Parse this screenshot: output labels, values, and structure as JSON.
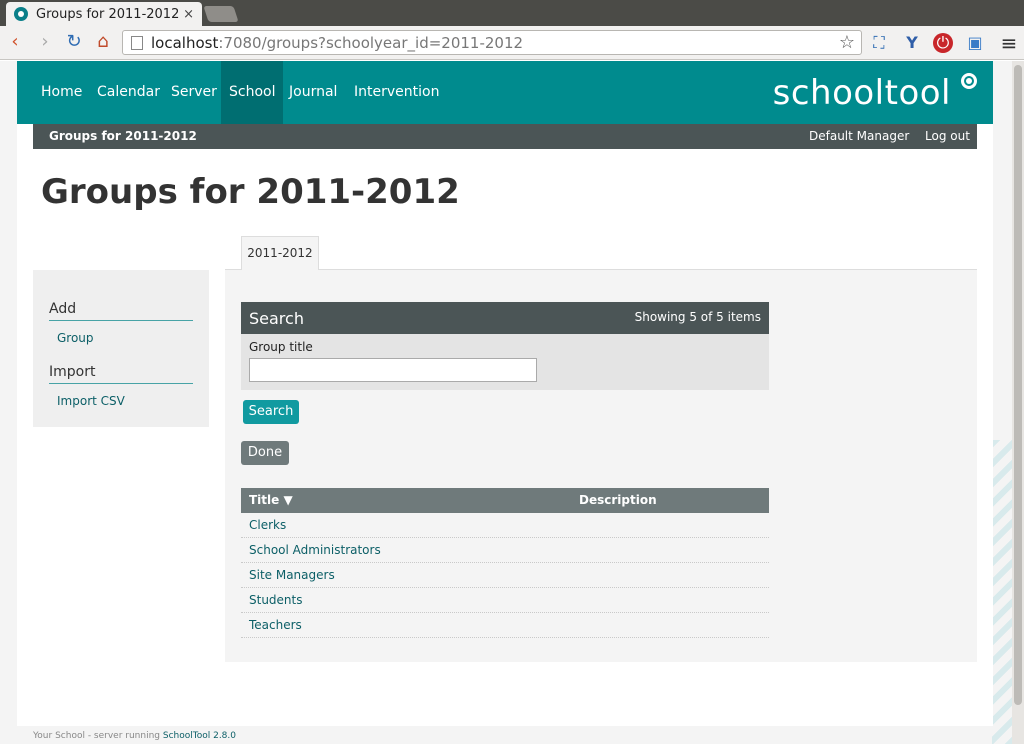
{
  "browser": {
    "tab_title": "Groups for 2011-2012",
    "tab_close": "×",
    "url_host": "localhost",
    "url_rest": ":7080/groups?schoolyear_id=2011-2012",
    "back": "‹",
    "forward": "›",
    "reload": "↻",
    "home": "⌂",
    "star": "☆",
    "ext1": "⛶",
    "ext2": "Y",
    "ext3": "⏻",
    "ext4": "▣",
    "menu": "≡"
  },
  "nav": {
    "items": [
      {
        "label": "Home"
      },
      {
        "label": "Calendar"
      },
      {
        "label": "Server"
      },
      {
        "label": "School"
      },
      {
        "label": "Journal"
      },
      {
        "label": "Intervention"
      }
    ],
    "brand": "schooltool"
  },
  "subnav": {
    "breadcrumb": "Groups for 2011-2012",
    "user": "Default Manager",
    "logout": "Log out"
  },
  "page_title": "Groups for 2011-2012",
  "sidebar": {
    "add_heading": "Add",
    "add_link": "Group",
    "import_heading": "Import",
    "import_link": "Import CSV"
  },
  "tab": "2011-2012",
  "search": {
    "title": "Search",
    "count": "Showing 5 of 5 items",
    "field_label": "Group title",
    "field_value": "",
    "button": "Search"
  },
  "done_button": "Done",
  "table": {
    "columns": {
      "title": "Title ▼",
      "description": "Description"
    },
    "rows": [
      {
        "title": "Clerks"
      },
      {
        "title": "School Administrators"
      },
      {
        "title": "Site Managers"
      },
      {
        "title": "Students"
      },
      {
        "title": "Teachers"
      }
    ]
  },
  "footer": {
    "text": "Your School - server running ",
    "link": "SchoolTool 2.8.0"
  },
  "colors": {
    "accent": "#008b8e",
    "dark": "#4b5556"
  }
}
